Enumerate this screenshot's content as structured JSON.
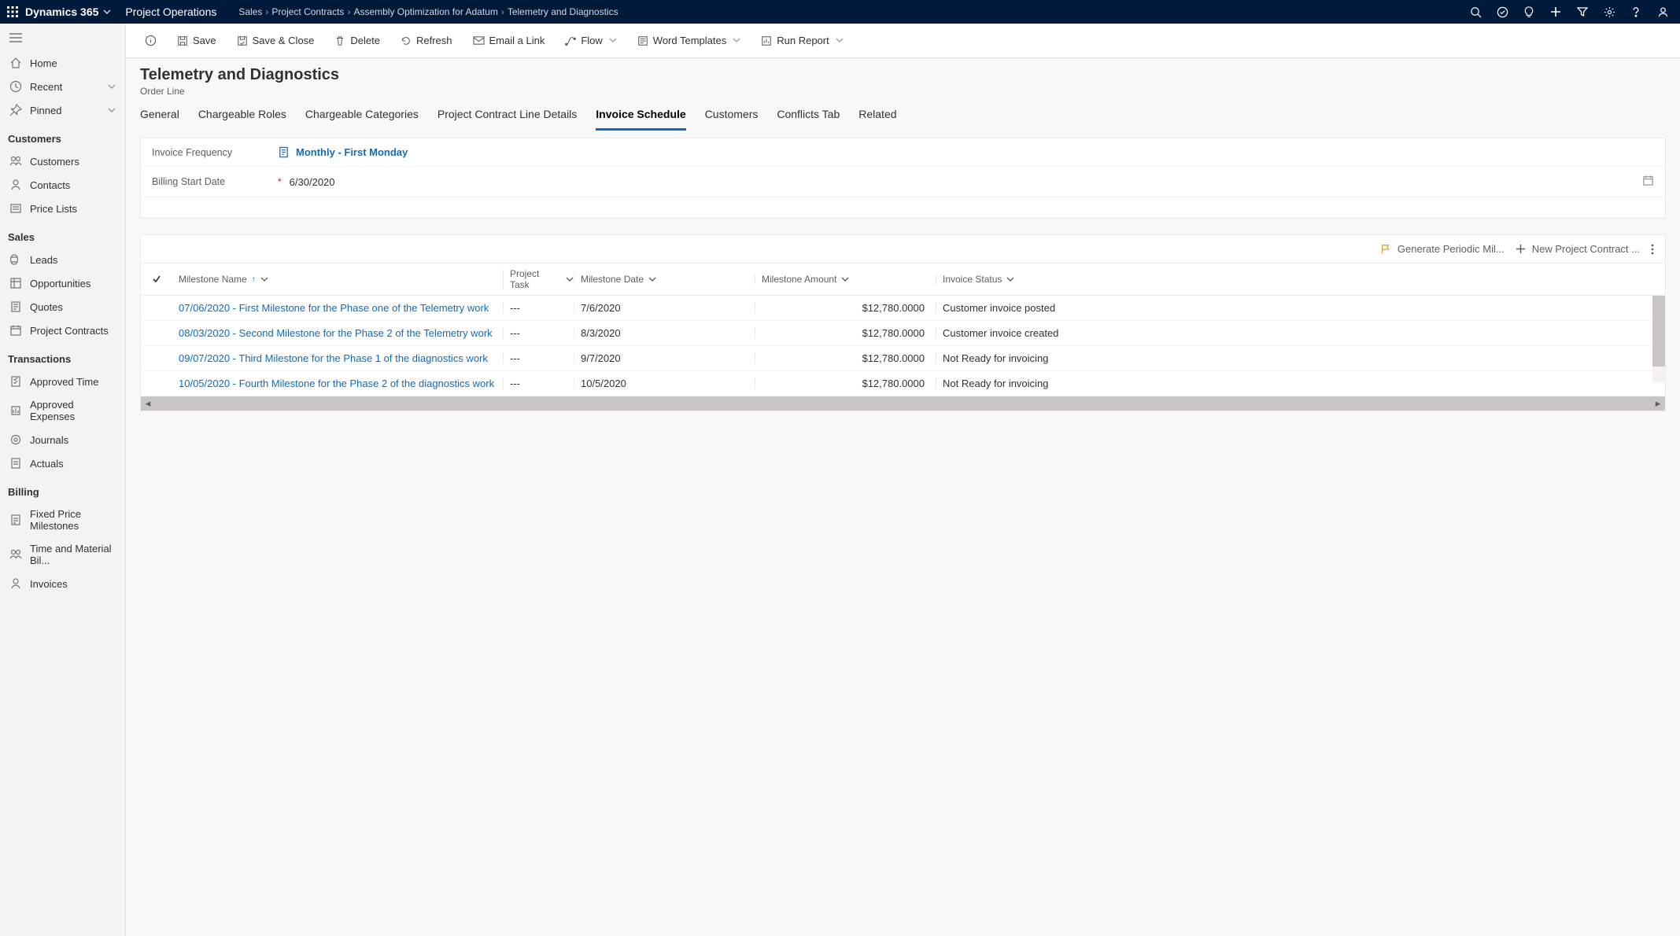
{
  "topbar": {
    "brand": "Dynamics 365",
    "app": "Project Operations",
    "crumbs": [
      "Sales",
      "Project Contracts",
      "Assembly Optimization for Adatum",
      "Telemetry and Diagnostics"
    ]
  },
  "leftnav": {
    "home": "Home",
    "recent": "Recent",
    "pinned": "Pinned",
    "groups": [
      {
        "title": "Customers",
        "items": [
          "Customers",
          "Contacts",
          "Price Lists"
        ]
      },
      {
        "title": "Sales",
        "items": [
          "Leads",
          "Opportunities",
          "Quotes",
          "Project Contracts"
        ]
      },
      {
        "title": "Transactions",
        "items": [
          "Approved Time",
          "Approved Expenses",
          "Journals",
          "Actuals"
        ]
      },
      {
        "title": "Billing",
        "items": [
          "Fixed Price Milestones",
          "Time and Material Bil...",
          "Invoices"
        ]
      }
    ]
  },
  "ribbon": {
    "save": "Save",
    "save_close": "Save & Close",
    "delete": "Delete",
    "refresh": "Refresh",
    "email": "Email a Link",
    "flow": "Flow",
    "word": "Word Templates",
    "report": "Run Report"
  },
  "page": {
    "title": "Telemetry and Diagnostics",
    "subtitle": "Order Line"
  },
  "tabs": [
    "General",
    "Chargeable Roles",
    "Chargeable Categories",
    "Project Contract Line Details",
    "Invoice Schedule",
    "Customers",
    "Conflicts Tab",
    "Related"
  ],
  "activeTab": "Invoice Schedule",
  "form": {
    "invoice_freq_label": "Invoice Frequency",
    "invoice_freq_value": "Monthly - First Monday",
    "billing_start_label": "Billing Start Date",
    "billing_start_value": "6/30/2020"
  },
  "grid": {
    "actions": {
      "generate": "Generate Periodic Mil...",
      "new": "New Project Contract ..."
    },
    "columns": {
      "name": "Milestone Name",
      "task": "Project Task",
      "date": "Milestone Date",
      "amount": "Milestone Amount",
      "status": "Invoice Status"
    },
    "rows": [
      {
        "name": "07/06/2020 - First Milestone for the Phase one of the Telemetry work",
        "task": "---",
        "date": "7/6/2020",
        "amount": "$12,780.0000",
        "status": "Customer invoice posted"
      },
      {
        "name": "08/03/2020 - Second Milestone for the Phase 2 of the Telemetry work",
        "task": "---",
        "date": "8/3/2020",
        "amount": "$12,780.0000",
        "status": "Customer invoice created"
      },
      {
        "name": "09/07/2020 -  Third Milestone for the Phase 1 of the diagnostics work",
        "task": "---",
        "date": "9/7/2020",
        "amount": "$12,780.0000",
        "status": "Not Ready for invoicing"
      },
      {
        "name": "10/05/2020 -  Fourth Milestone for the Phase 2 of the diagnostics work",
        "task": "---",
        "date": "10/5/2020",
        "amount": "$12,780.0000",
        "status": "Not Ready for invoicing"
      }
    ]
  }
}
